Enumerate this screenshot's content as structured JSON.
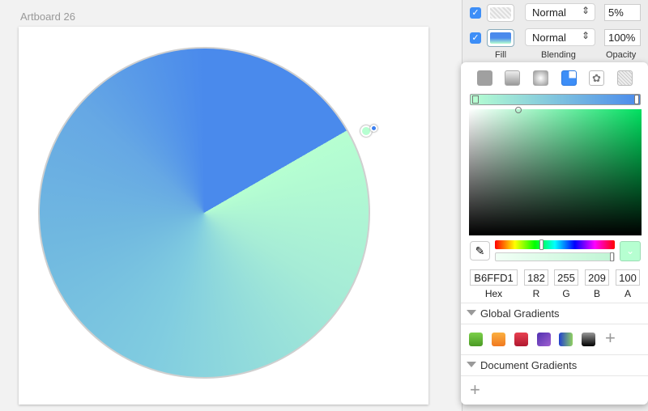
{
  "artboard": {
    "title": "Artboard 26"
  },
  "fills": [
    {
      "enabled": true,
      "blending": "Normal",
      "opacity": "5%"
    },
    {
      "enabled": true,
      "blending": "Normal",
      "opacity": "100%"
    }
  ],
  "labels": {
    "fill": "Fill",
    "blending": "Blending",
    "opacity": "Opacity"
  },
  "picker": {
    "fill_types": [
      "solid",
      "linear",
      "radial",
      "angular",
      "pattern",
      "noise"
    ],
    "selected_type": "angular",
    "gradient_stops": [
      "#B6FFD1",
      "#4A8AEC"
    ],
    "hex": "B6FFD1",
    "r": "182",
    "g": "255",
    "b": "209",
    "a": "100",
    "field_labels": {
      "hex": "Hex",
      "r": "R",
      "g": "G",
      "b": "B",
      "a": "A"
    },
    "global_gradients_title": "Global Gradients",
    "document_gradients_title": "Document Gradients",
    "global_gradients": [
      "#58b030",
      "#f5962a",
      "#d0283a",
      "#7040c0",
      "#4a7ae0",
      "#333333"
    ]
  },
  "icons": {
    "check": "✓",
    "updown": "⌃⌄",
    "eyedropper": "✎",
    "chevron": "⌄",
    "plus": "+"
  }
}
